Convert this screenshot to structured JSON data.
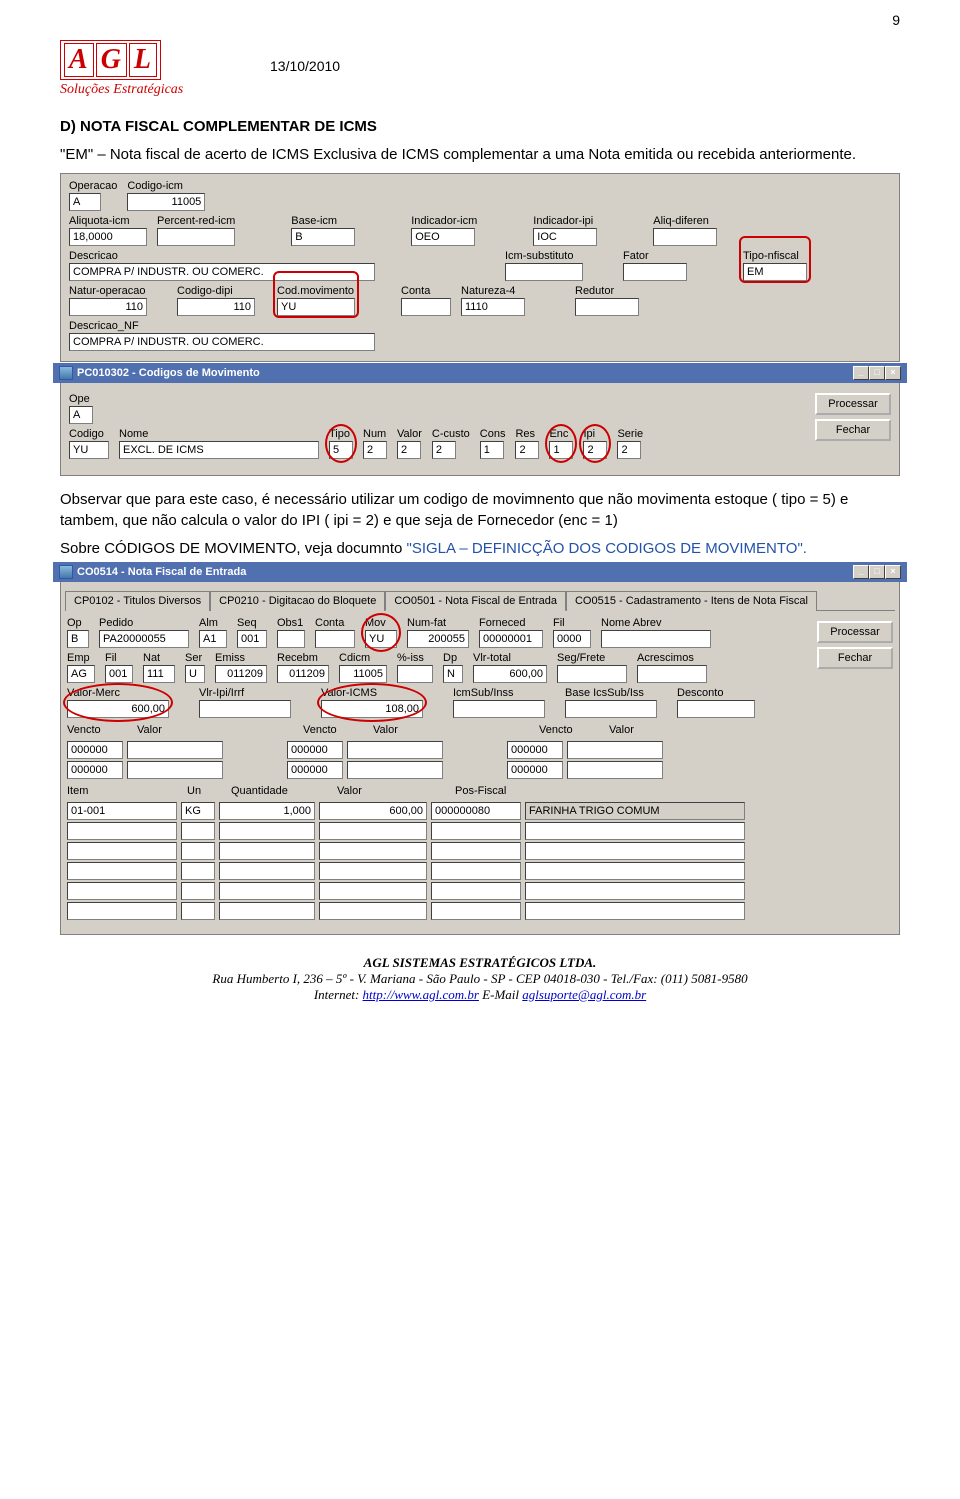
{
  "page_number": "9",
  "logo": {
    "letters": "AGL",
    "sub": "Soluções Estratégicas"
  },
  "date": "13/10/2010",
  "section_heading": "D)  NOTA FISCAL COMPLEMENTAR DE ICMS",
  "para1": "\"EM\" – Nota fiscal de acerto de ICMS Exclusiva de ICMS complementar a uma Nota emitida ou recebida anteriormente.",
  "form1": {
    "operacao": {
      "l": "Operacao",
      "v": "A"
    },
    "codigo_icm": {
      "l": "Codigo-icm",
      "v": "11005"
    },
    "aliquota_icm": {
      "l": "Aliquota-icm",
      "v": "18,0000"
    },
    "percent_red": {
      "l": "Percent-red-icm",
      "v": ""
    },
    "base_icm": {
      "l": "Base-icm",
      "v": "B"
    },
    "indicador_icm": {
      "l": "Indicador-icm",
      "v": "OEO"
    },
    "indicador_ipi": {
      "l": "Indicador-ipi",
      "v": "IOC"
    },
    "aliq_diferen": {
      "l": "Aliq-diferen",
      "v": ""
    },
    "descricao": {
      "l": "Descricao",
      "v": "COMPRA P/ INDUSTR. OU COMERC."
    },
    "icm_substituto": {
      "l": "Icm-substituto",
      "v": ""
    },
    "fator": {
      "l": "Fator",
      "v": ""
    },
    "tipo_nfiscal": {
      "l": "Tipo-nfiscal",
      "v": "EM"
    },
    "natur_operacao": {
      "l": "Natur-operacao",
      "v": "110"
    },
    "codigo_dipi": {
      "l": "Codigo-dipi",
      "v": "110"
    },
    "cod_movimento": {
      "l": "Cod.movimento",
      "v": "YU"
    },
    "conta": {
      "l": "Conta",
      "v": ""
    },
    "natureza4": {
      "l": "Natureza-4",
      "v": "1110"
    },
    "redutor": {
      "l": "Redutor",
      "v": ""
    },
    "descricao_nf": {
      "l": "Descricao_NF",
      "v": "COMPRA P/ INDUSTR. OU COMERC."
    }
  },
  "window2": {
    "title": "PC010302 - Codigos de Movimento",
    "ope": {
      "l": "Ope",
      "v": "A"
    },
    "codigo": {
      "l": "Codigo",
      "v": "YU"
    },
    "nome": {
      "l": "Nome",
      "v": "EXCL. DE ICMS"
    },
    "tipo": {
      "l": "Tipo",
      "v": "5"
    },
    "num": {
      "l": "Num",
      "v": "2"
    },
    "valor": {
      "l": "Valor",
      "v": "2"
    },
    "ccusto": {
      "l": "C-custo",
      "v": "2"
    },
    "cons": {
      "l": "Cons",
      "v": "1"
    },
    "res": {
      "l": "Res",
      "v": "2"
    },
    "enc": {
      "l": "Enc",
      "v": "1"
    },
    "ipi": {
      "l": "Ipi",
      "v": "2"
    },
    "serie": {
      "l": "Serie",
      "v": "2"
    },
    "btn_processar": "Processar",
    "btn_fechar": "Fechar"
  },
  "para2": "Observar que para este caso, é necessário utilizar um codigo de movimnento que não movimenta estoque ( tipo = 5) e tambem, que não calcula o valor do IPI ( ipi = 2) e que seja de Fornecedor (enc = 1)",
  "para3_a": "Sobre CÓDIGOS DE MOVIMENTO, veja documnto ",
  "para3_b": "\"SIGLA – DEFINICÇÃO DOS CODIGOS DE MOVIMENTO\".",
  "window3": {
    "title": "CO0514 - Nota Fiscal de Entrada",
    "tabs": [
      "CP0102  -  Titulos Diversos",
      "CP0210  -  Digitacao do Bloquete",
      "CO0501  -  Nota Fiscal de Entrada",
      "CO0515  -  Cadastramento - Itens de Nota Fiscal"
    ],
    "active_tab": 2,
    "btn_processar": "Processar",
    "btn_fechar": "Fechar",
    "row1": {
      "op": {
        "l": "Op",
        "v": "B"
      },
      "pedido": {
        "l": "Pedido",
        "v": "PA20000055"
      },
      "alm": {
        "l": "Alm",
        "v": "A1"
      },
      "seq": {
        "l": "Seq",
        "v": "001"
      },
      "obs1": {
        "l": "Obs1",
        "v": ""
      },
      "conta": {
        "l": "Conta",
        "v": ""
      },
      "mov": {
        "l": "Mov",
        "v": "YU"
      },
      "numfat": {
        "l": "Num-fat",
        "v": "200055"
      },
      "forneced": {
        "l": "Forneced",
        "v": "00000001"
      },
      "fil": {
        "l": "Fil",
        "v": "0000"
      },
      "nomeabrev": {
        "l": "Nome Abrev",
        "v": ""
      }
    },
    "row2": {
      "emp": {
        "l": "Emp",
        "v": "AG"
      },
      "fil": {
        "l": "Fil",
        "v": "001"
      },
      "nat": {
        "l": "Nat",
        "v": "111"
      },
      "ser": {
        "l": "Ser",
        "v": "U"
      },
      "emiss": {
        "l": "Emiss",
        "v": "011209"
      },
      "recebm": {
        "l": "Recebm",
        "v": "011209"
      },
      "cdicm": {
        "l": "Cdicm",
        "v": "11005"
      },
      "piss": {
        "l": "%-iss",
        "v": ""
      },
      "dp": {
        "l": "Dp",
        "v": "N"
      },
      "vlrtotal": {
        "l": "Vlr-total",
        "v": "600,00"
      },
      "segfrete": {
        "l": "Seg/Frete",
        "v": ""
      },
      "acrescimos": {
        "l": "Acrescimos",
        "v": ""
      }
    },
    "row3": {
      "valormerc": {
        "l": "Valor-Merc",
        "v": "600,00"
      },
      "vlripi": {
        "l": "Vlr-Ipi/Irrf",
        "v": ""
      },
      "valoricms": {
        "l": "Valor-ICMS",
        "v": "108,00"
      },
      "icmsub": {
        "l": "IcmSub/Inss",
        "v": ""
      },
      "baseics": {
        "l": "Base IcsSub/Iss",
        "v": ""
      },
      "desconto": {
        "l": "Desconto",
        "v": ""
      }
    },
    "venctos": {
      "l1": "Vencto",
      "l2": "Valor",
      "rows": [
        [
          "000000",
          "",
          "000000",
          "",
          "000000",
          ""
        ],
        [
          "000000",
          "",
          "000000",
          "",
          "000000",
          ""
        ]
      ]
    },
    "item_hdr": {
      "item": "Item",
      "un": "Un",
      "qtd": "Quantidade",
      "valor": "Valor",
      "posfiscal": "Pos-Fiscal"
    },
    "items": [
      {
        "item": "01-001",
        "un": "KG",
        "qtd": "1,000",
        "valor": "600,00",
        "posfiscal": "000000080",
        "desc": "FARINHA TRIGO COMUM"
      },
      {
        "item": "",
        "un": "",
        "qtd": "",
        "valor": "",
        "posfiscal": "",
        "desc": ""
      },
      {
        "item": "",
        "un": "",
        "qtd": "",
        "valor": "",
        "posfiscal": "",
        "desc": ""
      },
      {
        "item": "",
        "un": "",
        "qtd": "",
        "valor": "",
        "posfiscal": "",
        "desc": ""
      },
      {
        "item": "",
        "un": "",
        "qtd": "",
        "valor": "",
        "posfiscal": "",
        "desc": ""
      },
      {
        "item": "",
        "un": "",
        "qtd": "",
        "valor": "",
        "posfiscal": "",
        "desc": ""
      }
    ]
  },
  "footer": {
    "l1": "AGL SISTEMAS ESTRATÉGICOS LTDA.",
    "l2": "Rua Humberto I, 236 – 5º - V. Mariana - São Paulo - SP - CEP 04018-030 - Tel./Fax: (011) 5081-9580",
    "l3a": "Internet: ",
    "url": "http://www.agl.com.br",
    "l3b": "    E-Mail ",
    "mail": "aglsuporte@agl.com.br"
  }
}
